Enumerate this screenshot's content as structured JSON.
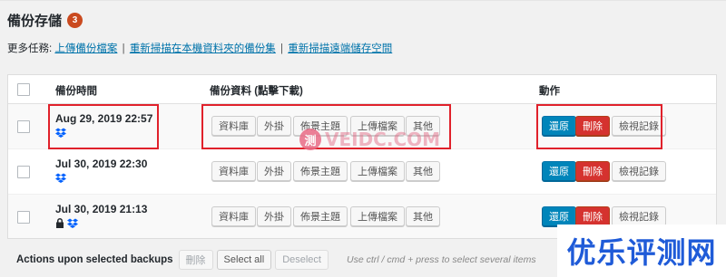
{
  "page": {
    "title": "備份存儲",
    "count_badge": "3",
    "more_tasks_label": "更多任務:",
    "links": [
      "上傳備份檔案",
      "重新掃描在本機資料夾的備份集",
      "重新掃描遠端儲存空間"
    ],
    "separator": "|"
  },
  "table": {
    "headers": {
      "time": "備份時間",
      "data": "備份資料 (點擊下載)",
      "actions": "動作"
    },
    "rows": [
      {
        "date": "Aug 29, 2019 22:57",
        "icons": [
          "dropbox-icon"
        ]
      },
      {
        "date": "Jul 30, 2019 22:30",
        "icons": [
          "dropbox-icon"
        ]
      },
      {
        "date": "Jul 30, 2019 21:13",
        "icons": [
          "lock-icon",
          "dropbox-icon"
        ]
      }
    ],
    "data_buttons": [
      "資料庫",
      "外掛",
      "佈景主題",
      "上傳檔案",
      "其他"
    ],
    "action_buttons": {
      "restore": "還原",
      "delete": "刪除",
      "view_log": "檢視記錄"
    }
  },
  "footer": {
    "label": "Actions upon selected backups",
    "delete": "刪除",
    "select_all": "Select all",
    "deselect": "Deselect",
    "hint": "Use ctrl / cmd + press to select several items"
  },
  "watermark": {
    "logo_char": "测",
    "text": "VEIDC.COM",
    "corner_text": "优乐评测网"
  },
  "colors": {
    "accent_blue": "#0085ba",
    "danger_red": "#d5322f",
    "highlight_red": "#e0212b",
    "badge": "#ca4a1f",
    "link": "#0073aa",
    "corner_brand": "#1f5bd8"
  }
}
